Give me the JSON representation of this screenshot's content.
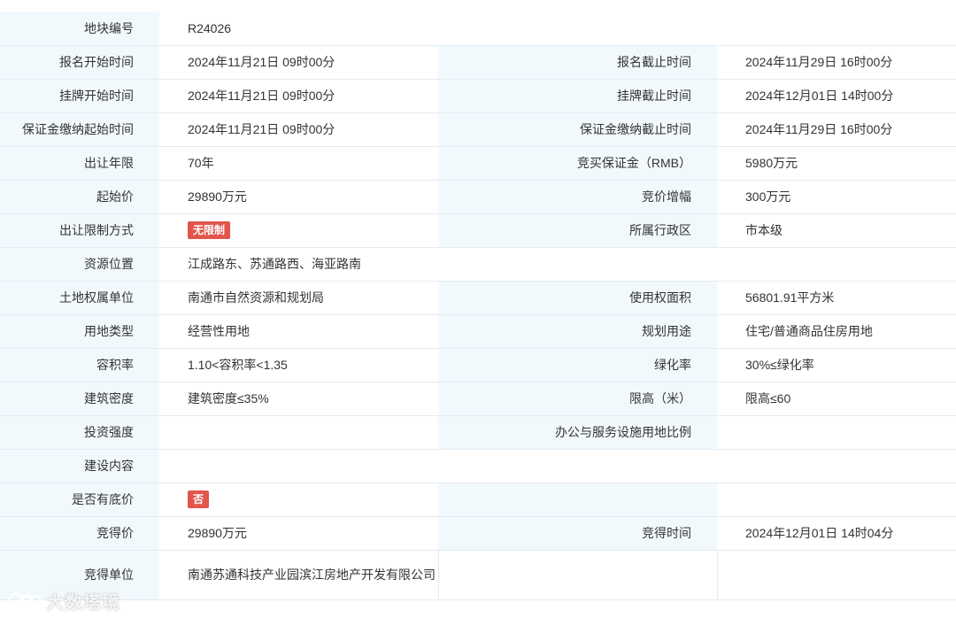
{
  "colors": {
    "label_bg": "#f2f9fd",
    "border": "#e3ecf3",
    "badge_red": "#e2554d"
  },
  "rows": {
    "r0": {
      "l1": "地块编号",
      "v1": "R24026"
    },
    "r1": {
      "l1": "报名开始时间",
      "v1": "2024年11月21日 09时00分",
      "l2": "报名截止时间",
      "v2": "2024年11月29日 16时00分"
    },
    "r2": {
      "l1": "挂牌开始时间",
      "v1": "2024年11月21日 09时00分",
      "l2": "挂牌截止时间",
      "v2": "2024年12月01日 14时00分"
    },
    "r3": {
      "l1": "保证金缴纳起始时间",
      "v1": "2024年11月21日 09时00分",
      "l2": "保证金缴纳截止时间",
      "v2": "2024年11月29日 16时00分"
    },
    "r4": {
      "l1": "出让年限",
      "v1": "70年",
      "l2": "竞买保证金（RMB）",
      "v2": "5980万元"
    },
    "r5": {
      "l1": "起始价",
      "v1": "29890万元",
      "l2": "竞价增幅",
      "v2": "300万元"
    },
    "r6": {
      "l1": "出让限制方式",
      "v1": "无限制",
      "l2": "所属行政区",
      "v2": "市本级"
    },
    "r7": {
      "l1": "资源位置",
      "v1": "江成路东、苏通路西、海亚路南"
    },
    "r8": {
      "l1": "土地权属单位",
      "v1": "南通市自然资源和规划局",
      "l2": "使用权面积",
      "v2": "56801.91平方米"
    },
    "r9": {
      "l1": "用地类型",
      "v1": "经营性用地",
      "l2": "规划用途",
      "v2": "住宅/普通商品住房用地"
    },
    "r10": {
      "l1": "容积率",
      "v1": "1.10<容积率<1.35",
      "l2": "绿化率",
      "v2": "30%≤绿化率"
    },
    "r11": {
      "l1": "建筑密度",
      "v1": "建筑密度≤35%",
      "l2": "限高（米）",
      "v2": "限高≤60"
    },
    "r12": {
      "l1": "投资强度",
      "v1": "",
      "l2": "办公与服务设施用地比例",
      "v2": ""
    },
    "r13": {
      "l1": "建设内容",
      "v1": ""
    },
    "r14": {
      "l1": "是否有底价",
      "v1": "否",
      "l2": "",
      "v2": ""
    },
    "r15": {
      "l1": "竞得价",
      "v1": "29890万元",
      "l2": "竞得时间",
      "v2": "2024年12月01日 14时04分"
    },
    "r16": {
      "l1": "竞得单位",
      "v1": "南通苏通科技产业园滨江房地产开发有限公司",
      "l2": "",
      "v2": ""
    }
  },
  "watermark": {
    "text": "大数塔境"
  }
}
